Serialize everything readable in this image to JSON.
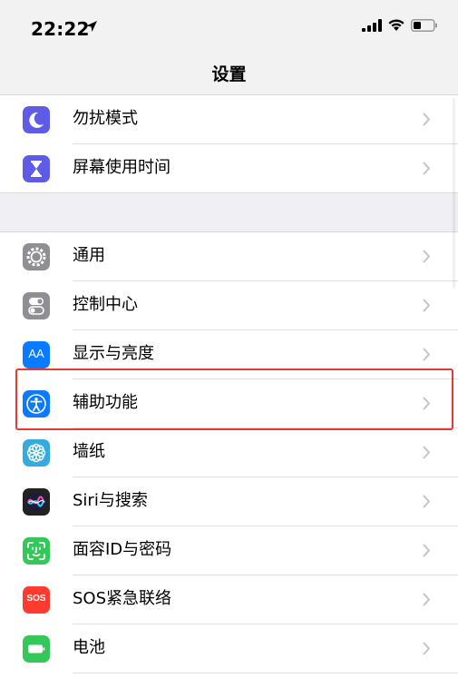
{
  "status_bar": {
    "time": "22:22"
  },
  "nav": {
    "title": "设置"
  },
  "colors": {
    "dnd": "#5e5ce6",
    "screen_time": "#5e5ce6",
    "general": "#8e8e93",
    "control_center": "#8e8e93",
    "display": "#0a7aff",
    "accessibility": "#0a7aff",
    "wallpaper": "#35aadc",
    "siri": "#222222",
    "face_id": "#34c759",
    "sos": "#ff3b30",
    "battery": "#34c759",
    "highlight": "#e53935"
  },
  "group1": [
    {
      "id": "do-not-disturb",
      "label": "勿扰模式",
      "icon": "moon-icon"
    },
    {
      "id": "screen-time",
      "label": "屏幕使用时间",
      "icon": "hourglass-icon"
    }
  ],
  "group2": [
    {
      "id": "general",
      "label": "通用",
      "icon": "gear-icon"
    },
    {
      "id": "control-center",
      "label": "控制中心",
      "icon": "toggles-icon"
    },
    {
      "id": "display-brightness",
      "label": "显示与亮度",
      "icon": "text-size-icon",
      "icon_text": "AA"
    },
    {
      "id": "accessibility",
      "label": "辅助功能",
      "icon": "accessibility-icon",
      "highlighted": true
    },
    {
      "id": "wallpaper",
      "label": "墙纸",
      "icon": "flower-icon"
    },
    {
      "id": "siri-search",
      "label": "Siri与搜索",
      "icon": "siri-icon"
    },
    {
      "id": "face-id-passcode",
      "label": "面容ID与密码",
      "icon": "face-id-icon"
    },
    {
      "id": "emergency-sos",
      "label": "SOS紧急联络",
      "icon": "sos-icon",
      "icon_text": "SOS"
    },
    {
      "id": "battery",
      "label": "电池",
      "icon": "battery-icon"
    }
  ]
}
